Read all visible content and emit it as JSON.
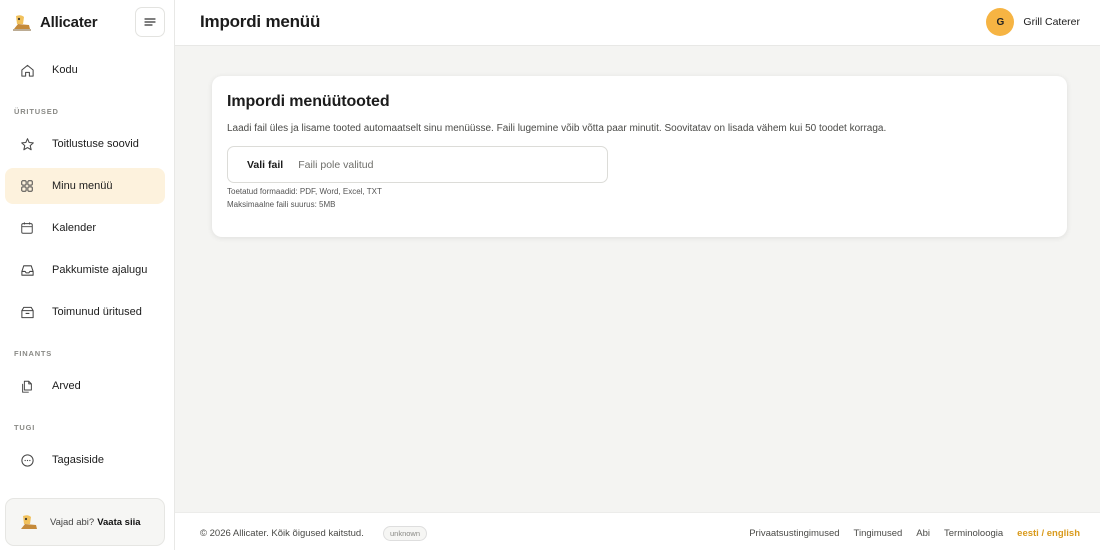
{
  "brand": {
    "name": "Allicater"
  },
  "sidebar": {
    "home": {
      "label": "Kodu",
      "icon": "home-icon"
    },
    "sections": [
      {
        "label": "ÜRITUSED"
      },
      {
        "label": "FINANTS"
      },
      {
        "label": "TUGI"
      }
    ],
    "items": [
      {
        "label": "Toitlustuse soovid",
        "icon": "star-icon"
      },
      {
        "label": "Minu menüü",
        "icon": "grid-icon",
        "active": true
      },
      {
        "label": "Kalender",
        "icon": "calendar-icon"
      },
      {
        "label": "Pakkumiste ajalugu",
        "icon": "inbox-icon"
      },
      {
        "label": "Toimunud üritused",
        "icon": "archive-icon"
      },
      {
        "label": "Arved",
        "icon": "documents-icon"
      },
      {
        "label": "Tagasiside",
        "icon": "chat-icon"
      }
    ],
    "help": {
      "text": "Vajad abi?",
      "link": "Vaata siia"
    }
  },
  "header": {
    "title": "Impordi menüü",
    "user": {
      "initial": "G",
      "name": "Grill Caterer"
    }
  },
  "card": {
    "title": "Impordi menüütooted",
    "description": "Laadi fail üles ja lisame tooted automaatselt sinu menüüsse. Faili lugemine võib võtta paar minutit. Soovitatav on lisada vähem kui 50 toodet korraga.",
    "file_button": "Vali fail",
    "file_status": "Faili pole valitud",
    "formats_hint": "Toetatud formaadid: PDF, Word, Excel, TXT",
    "size_hint": "Maksimaalne faili suurus: 5MB"
  },
  "footer": {
    "copyright": "© 2026 Allicater. Kõik õigused kaitstud.",
    "badge": "unknown",
    "links": [
      "Privaatsustingimused",
      "Tingimused",
      "Abi",
      "Terminoloogia"
    ],
    "language": "eesti / english"
  },
  "colors": {
    "accent": "#f6b443",
    "active_bg": "#fdf2dd",
    "lang_link": "#d99a1c"
  }
}
